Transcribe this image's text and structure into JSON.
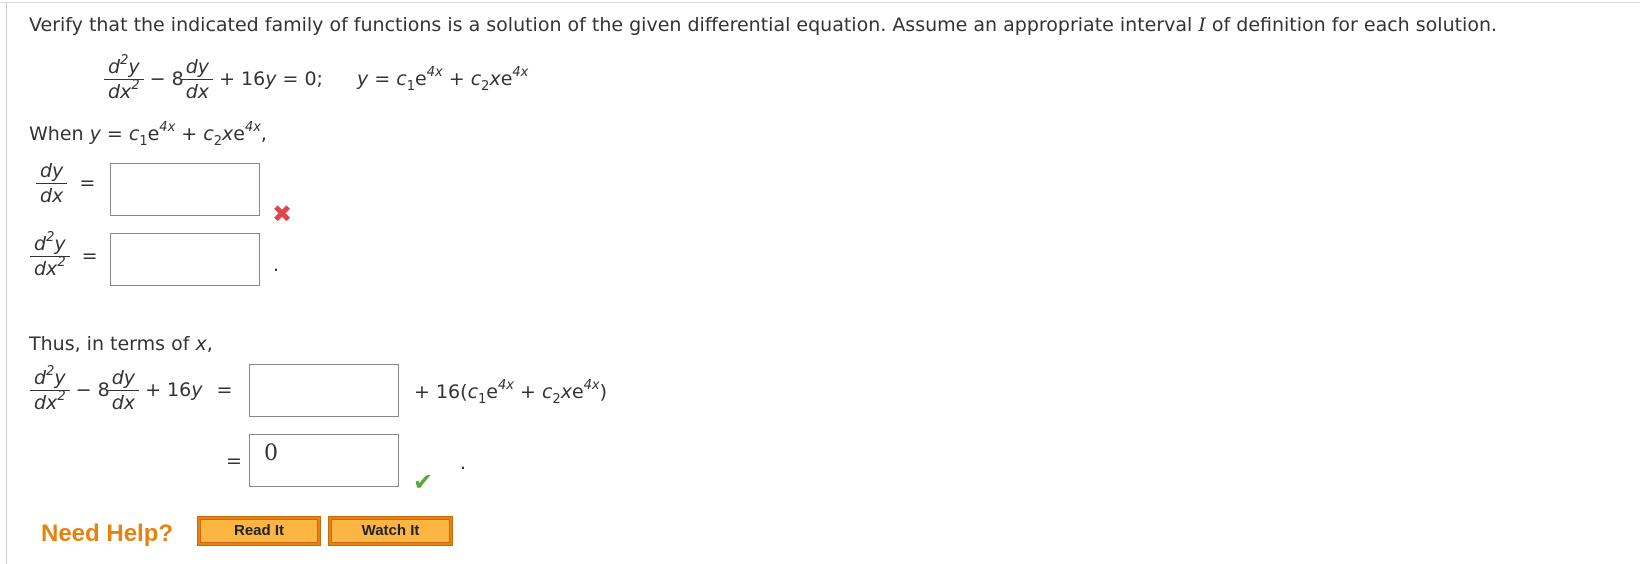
{
  "instructions": {
    "part1": "Verify that the indicated family of functions is a solution of the given differential equation. Assume an appropriate interval ",
    "interval_var": "I",
    "part2": " of definition for each solution."
  },
  "equation": {
    "d2y_num": "d",
    "d2y_num_sup": "2",
    "d2y_num_y": "y",
    "d2y_den": "dx",
    "d2y_den_sup": "2",
    "minus8": "− 8",
    "dy_num": "dy",
    "dy_den": "dx",
    "plus16y": "+ 16",
    "y": "y",
    "eq_zero": " = 0;",
    "solution_y": "y",
    "solution_eq": " = ",
    "c1": "c",
    "sub1": "1",
    "e": "e",
    "exp": "4x",
    "plus": " + ",
    "c2": "c",
    "sub2": "2",
    "x": "x"
  },
  "when": {
    "label": "When ",
    "y": "y",
    "eq": " = ",
    "comma": ","
  },
  "derivatives": {
    "dy_dx": {
      "num": "dy",
      "den": "dx",
      "eq": "=",
      "value": "",
      "status": "incorrect"
    },
    "d2y_dx2": {
      "num_d": "d",
      "num_sup": "2",
      "num_y": "y",
      "den": "dx",
      "den_sup": "2",
      "eq": "=",
      "value": "",
      "period": "."
    }
  },
  "thus": {
    "label": "Thus, in terms of ",
    "x": "x",
    "comma": ",",
    "lhs_minus8": "− 8",
    "lhs_plus16": "+ 16",
    "lhs_y": "y",
    "eq": "=",
    "box1_value": "",
    "rhs_plus16": "+ 16(",
    "rhs_close": ")",
    "eq2": "=",
    "box2_value": "0",
    "box2_status": "correct",
    "period": "."
  },
  "help": {
    "label": "Need Help?",
    "read_it": "Read It",
    "watch_it": "Watch It"
  },
  "colors": {
    "help_orange": "#e8820f",
    "incorrect_red": "#e0474c",
    "correct_green": "#5aa93d"
  },
  "icons": {
    "incorrect": "x-mark-icon",
    "correct": "check-mark-icon"
  }
}
